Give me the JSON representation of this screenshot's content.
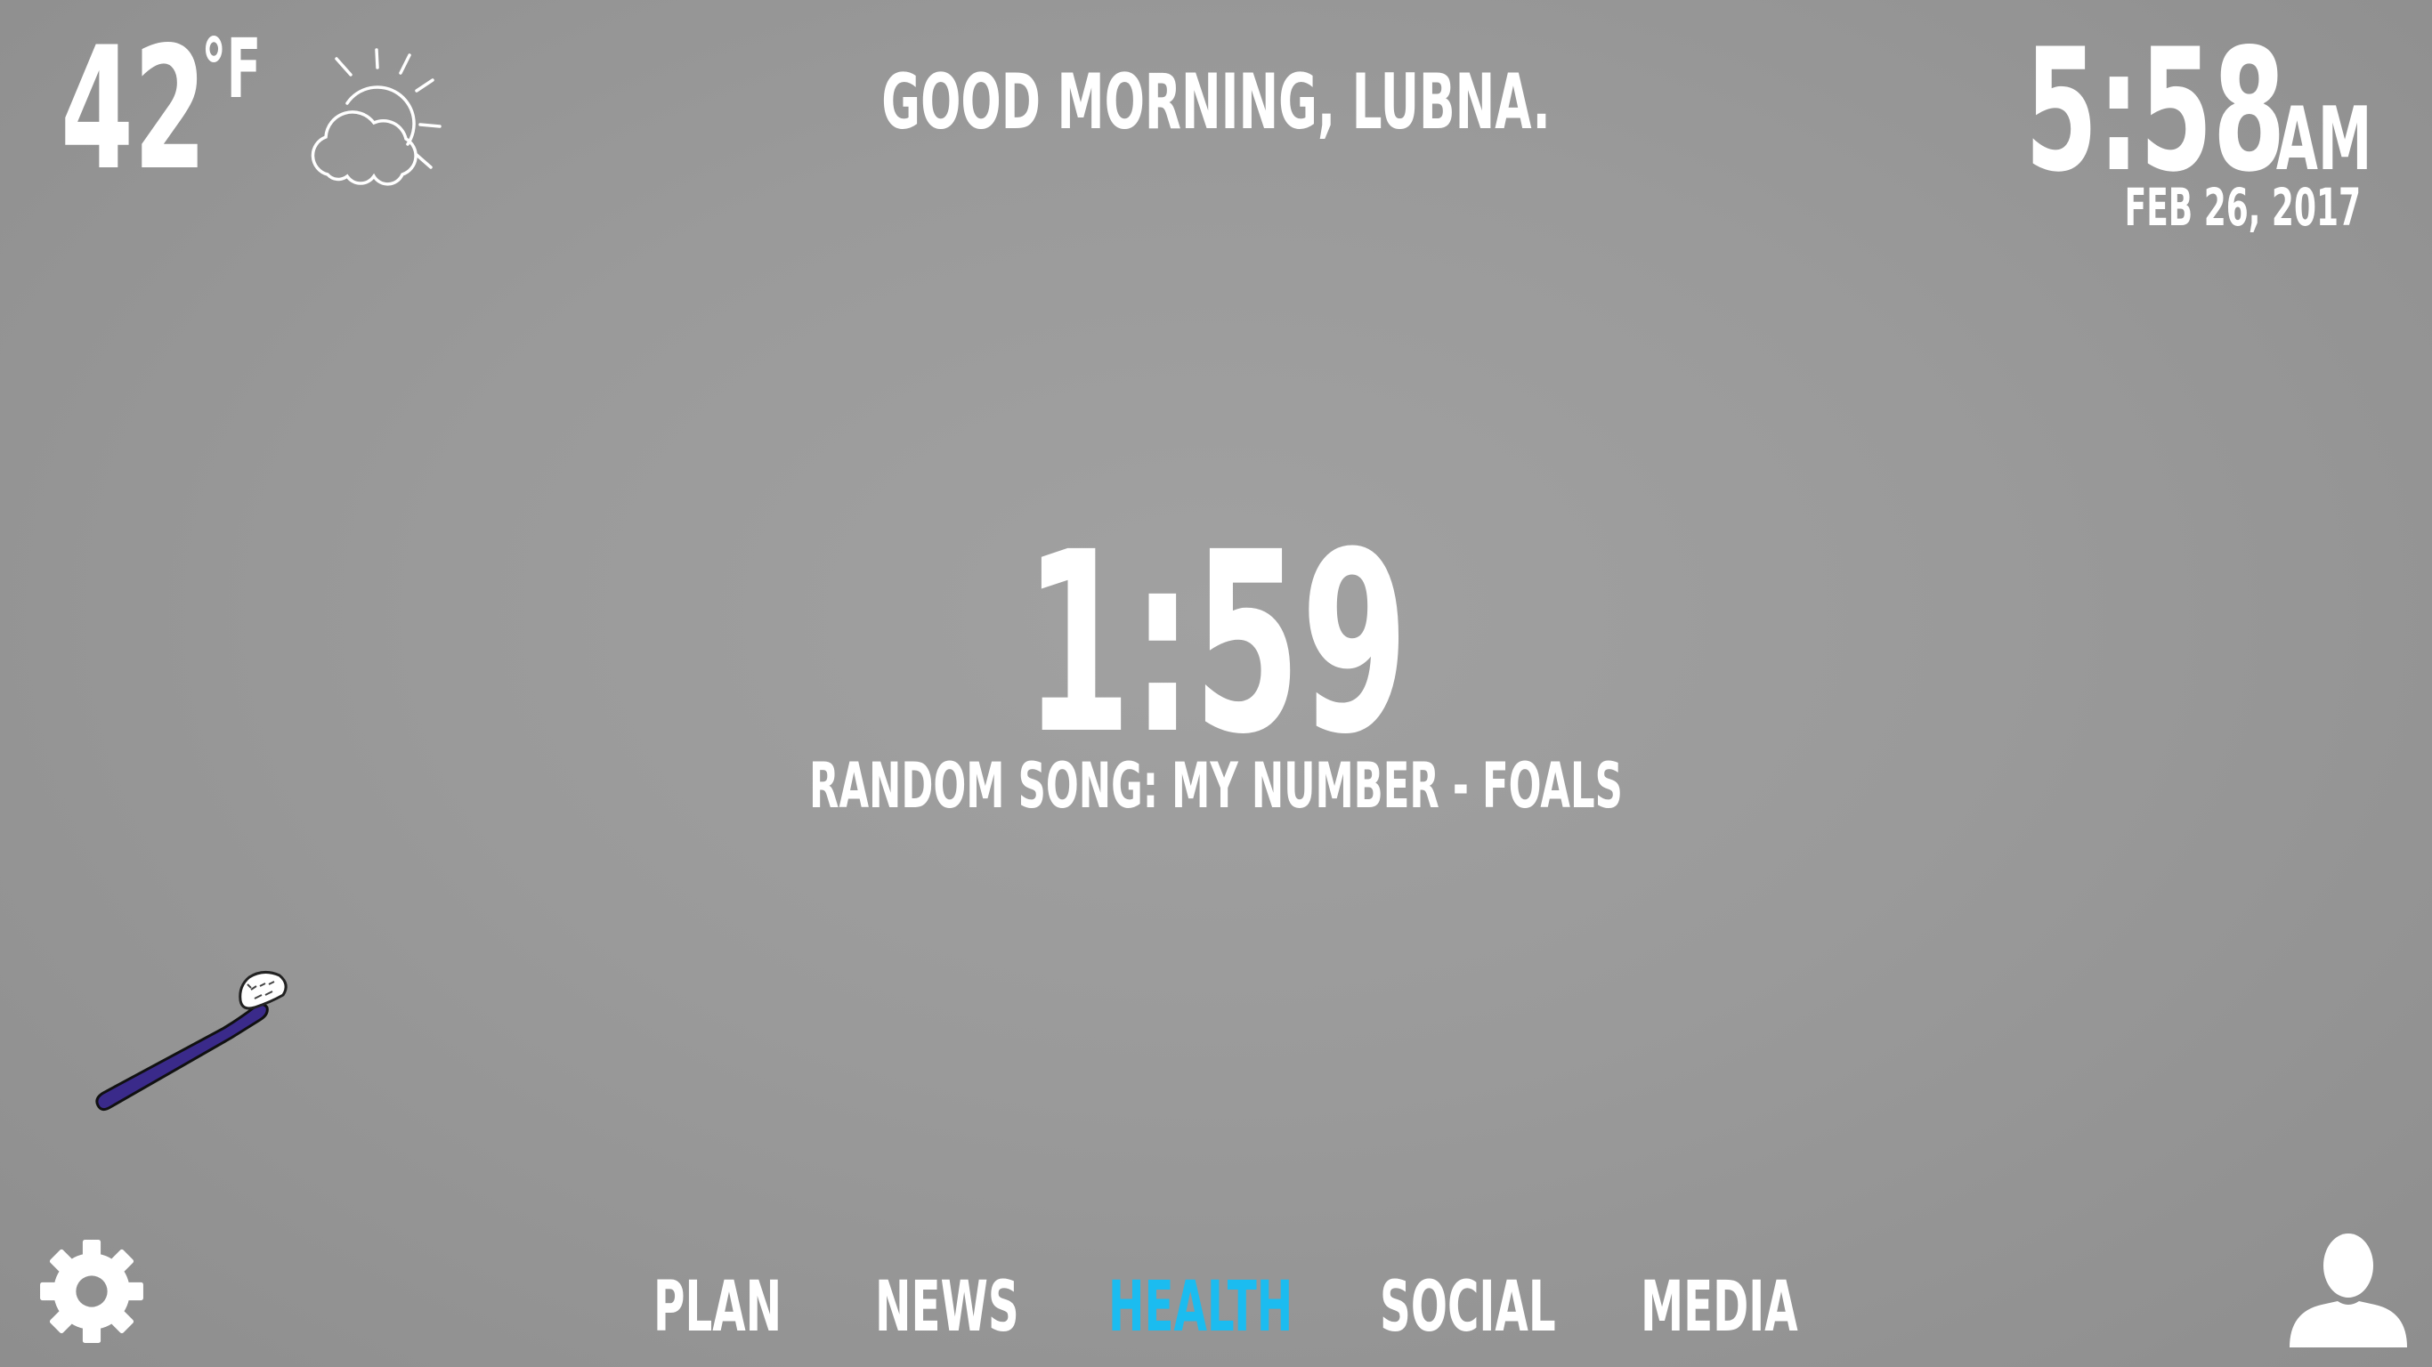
{
  "weather": {
    "temperature": "42",
    "unit": "°F",
    "icon": "partly-cloudy-icon"
  },
  "greeting": "GOOD MORNING, LUBNA.",
  "clock": {
    "time": "5:58",
    "ampm": "AM",
    "date": "FEB 26, 2017"
  },
  "timer": {
    "value": "1:59",
    "song": "RANDOM SONG: MY NUMBER - FOALS"
  },
  "toothbrush": {
    "icon": "toothbrush-icon",
    "color": "#3a2a8a"
  },
  "nav": {
    "items": [
      {
        "label": "PLAN"
      },
      {
        "label": "NEWS"
      },
      {
        "label": "HEALTH"
      },
      {
        "label": "SOCIAL"
      },
      {
        "label": "MEDIA"
      }
    ],
    "active": "HEALTH",
    "active_color": "#1bbcf0"
  },
  "icons": {
    "settings": "gear-icon",
    "profile": "user-icon"
  }
}
